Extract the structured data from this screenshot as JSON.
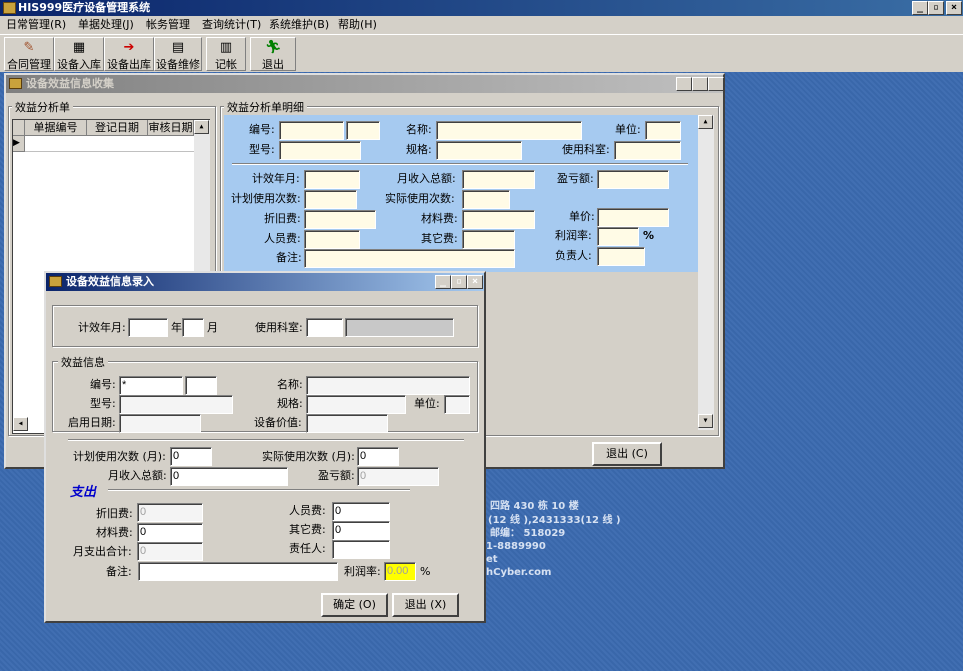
{
  "app": {
    "title": "HIS999医疗设备管理系统",
    "menus": [
      "日常管理(R)",
      "单据处理(J)",
      "帐务管理",
      "查询统计(T)",
      "系统维护(B)",
      "帮助(H)"
    ],
    "tools": [
      "合同管理",
      "设备入库",
      "设备出库",
      "设备维修",
      "记帐",
      "退出"
    ],
    "title_buttons": [
      "_",
      "▫",
      "×"
    ]
  },
  "desktop": {
    "lines": [
      "四路 430 栋 10 楼",
      "(12 线 ),2431333(12 线 )",
      "邮编： 518029",
      "1-8889990",
      "et",
      "hCyber.com"
    ]
  },
  "collect_window": {
    "title": "设备效益信息收集",
    "list_group": "效益分析单",
    "columns": [
      "单据编号",
      "登记日期",
      "审核日期"
    ],
    "detail_group": "效益分析单明细",
    "labels": {
      "code": "编号:",
      "name": "名称:",
      "unit": "单位:",
      "model": "型号:",
      "spec": "规格:",
      "dept": "使用科室:",
      "month": "计效年月:",
      "income": "月收入总额:",
      "profit": "盈亏额:",
      "plan_count": "计划使用次数:",
      "actual_count": "实际使用次数:",
      "depreciation": "折旧费:",
      "material": "材料费:",
      "price": "单价:",
      "staff": "人员费:",
      "other": "其它费:",
      "rate": "利润率:",
      "percent": "%",
      "remark": "备注:",
      "owner": "负责人:"
    },
    "exit_button": "退出 (C)"
  },
  "entry_dialog": {
    "title": "设备效益信息录入",
    "labels": {
      "month": "计效年月:",
      "year": "年",
      "mon": "月",
      "dept": "使用科室:",
      "group": "效益信息",
      "code": "编号:",
      "name": "名称:",
      "model": "型号:",
      "spec": "规格:",
      "unit": "单位:",
      "start_date": "启用日期:",
      "value": "设备价值:",
      "plan_count": "计划使用次数 (月):",
      "actual_count": "实际使用次数 (月):",
      "income": "月收入总额:",
      "profit": "盈亏额:",
      "expense": "支出",
      "depreciation": "折旧费:",
      "staff": "人员费:",
      "material": "材料费:",
      "other": "其它费:",
      "total": "月支出合计:",
      "owner": "责任人:",
      "remark": "备注:",
      "rate": "利润率:",
      "percent": "%"
    },
    "values": {
      "code": "*",
      "plan_count": "0",
      "actual_count": "0",
      "income": "0",
      "profit": "0",
      "depreciation": "0",
      "staff": "0",
      "material": "0",
      "other": "0",
      "total": "0",
      "rate": "0.00"
    },
    "ok_button": "确定 (O)",
    "exit_button": "退出 (X)"
  }
}
